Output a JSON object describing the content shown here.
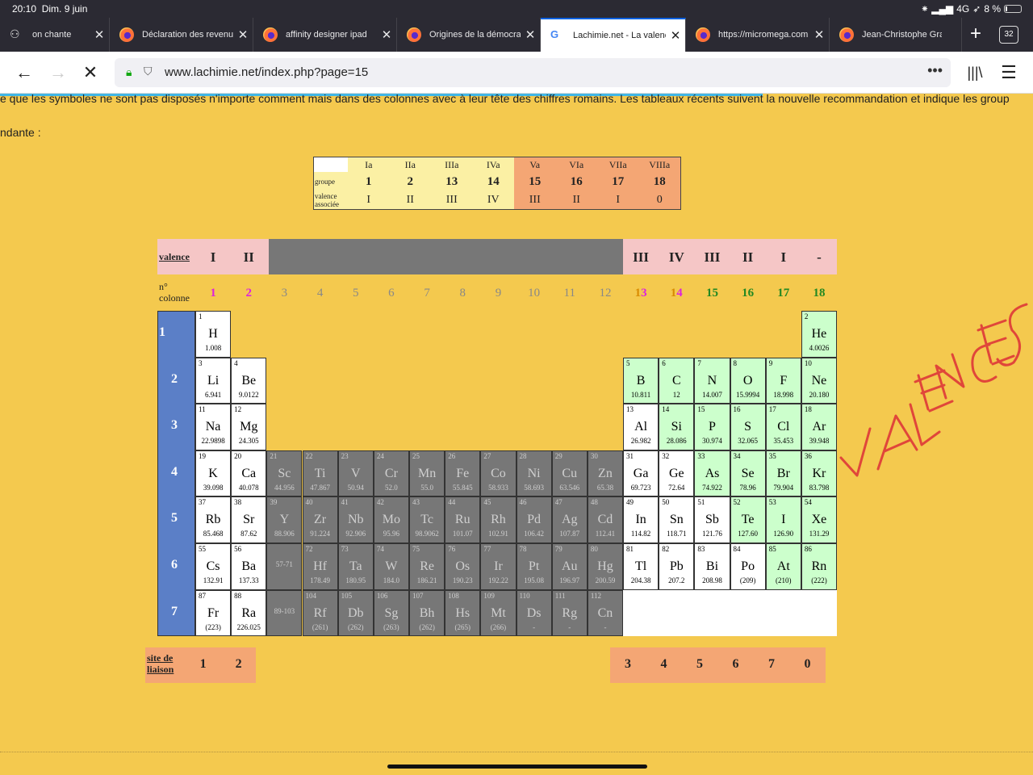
{
  "status": {
    "time": "20:10",
    "date": "Dim. 9 juin",
    "network": "4G",
    "battery": "8 %"
  },
  "tabs": [
    {
      "label": "on chante",
      "icon": "mask-icon",
      "x": 0
    },
    {
      "label": "Déclaration des revenus",
      "icon": "firefox-icon"
    },
    {
      "label": "affinity designer ipad",
      "icon": "firefox-icon"
    },
    {
      "label": "Origines de la démocratie",
      "icon": "firefox-icon"
    },
    {
      "label": "Lachimie.net - La valence",
      "icon": "google-icon",
      "active": true
    },
    {
      "label": "https://micromega.com",
      "icon": "firefox-icon"
    },
    {
      "label": "Jean-Christophe Granier",
      "icon": "firefox-icon"
    }
  ],
  "tab_count": "32",
  "url": "www.lachimie.net/index.php?page=15",
  "intro": {
    "line1": "e que les symboles ne sont pas disposés n'importe comment mais dans des colonnes avec à leur tête des chiffres romains. Les tableaux récents suivent la nouvelle recommandation et indique les group",
    "line2": "ndante :"
  },
  "group_table": {
    "roman": [
      "Ia",
      "IIa",
      "IIIa",
      "IVa",
      "Va",
      "VIa",
      "VIIa",
      "VIIIa"
    ],
    "groupe_label": "groupe",
    "groups": [
      "1",
      "2",
      "13",
      "14",
      "15",
      "16",
      "17",
      "18"
    ],
    "valence_label": "valence associée",
    "valences": [
      "I",
      "II",
      "III",
      "IV",
      "III",
      "II",
      "I",
      "0"
    ]
  },
  "periodic": {
    "valence_label": "valence",
    "valence_row": [
      "I",
      "II",
      "III",
      "IV",
      "III",
      "II",
      "I",
      "-"
    ],
    "col_label": "n° colonne",
    "columns": [
      "1",
      "2",
      "3",
      "4",
      "5",
      "6",
      "7",
      "8",
      "9",
      "10",
      "11",
      "12",
      "13",
      "14",
      "15",
      "16",
      "17",
      "18"
    ],
    "periods": [
      "1",
      "2",
      "3",
      "4",
      "5",
      "6",
      "7"
    ],
    "elements": [
      {
        "n": "1",
        "s": "H",
        "m": "1.008",
        "c": 1,
        "r": 1
      },
      {
        "n": "2",
        "s": "He",
        "m": "4.0026",
        "c": 18,
        "r": 1
      },
      {
        "n": "3",
        "s": "Li",
        "m": "6.941",
        "c": 1,
        "r": 2
      },
      {
        "n": "4",
        "s": "Be",
        "m": "9.0122",
        "c": 2,
        "r": 2
      },
      {
        "n": "5",
        "s": "B",
        "m": "10.811",
        "c": 13,
        "r": 2
      },
      {
        "n": "6",
        "s": "C",
        "m": "12",
        "c": 14,
        "r": 2
      },
      {
        "n": "7",
        "s": "N",
        "m": "14.007",
        "c": 15,
        "r": 2
      },
      {
        "n": "8",
        "s": "O",
        "m": "15.9994",
        "c": 16,
        "r": 2
      },
      {
        "n": "9",
        "s": "F",
        "m": "18.998",
        "c": 17,
        "r": 2
      },
      {
        "n": "10",
        "s": "Ne",
        "m": "20.180",
        "c": 18,
        "r": 2
      },
      {
        "n": "11",
        "s": "Na",
        "m": "22.9898",
        "c": 1,
        "r": 3
      },
      {
        "n": "12",
        "s": "Mg",
        "m": "24.305",
        "c": 2,
        "r": 3
      },
      {
        "n": "13",
        "s": "Al",
        "m": "26.982",
        "c": 13,
        "r": 3
      },
      {
        "n": "14",
        "s": "Si",
        "m": "28.086",
        "c": 14,
        "r": 3
      },
      {
        "n": "15",
        "s": "P",
        "m": "30.974",
        "c": 15,
        "r": 3
      },
      {
        "n": "16",
        "s": "S",
        "m": "32.065",
        "c": 16,
        "r": 3
      },
      {
        "n": "17",
        "s": "Cl",
        "m": "35.453",
        "c": 17,
        "r": 3
      },
      {
        "n": "18",
        "s": "Ar",
        "m": "39.948",
        "c": 18,
        "r": 3
      },
      {
        "n": "19",
        "s": "K",
        "m": "39.098",
        "c": 1,
        "r": 4
      },
      {
        "n": "20",
        "s": "Ca",
        "m": "40.078",
        "c": 2,
        "r": 4
      },
      {
        "n": "21",
        "s": "Sc",
        "m": "44.956",
        "c": 3,
        "r": 4
      },
      {
        "n": "22",
        "s": "Ti",
        "m": "47.867",
        "c": 4,
        "r": 4
      },
      {
        "n": "23",
        "s": "V",
        "m": "50.94",
        "c": 5,
        "r": 4
      },
      {
        "n": "24",
        "s": "Cr",
        "m": "52.0",
        "c": 6,
        "r": 4
      },
      {
        "n": "25",
        "s": "Mn",
        "m": "55.0",
        "c": 7,
        "r": 4
      },
      {
        "n": "26",
        "s": "Fe",
        "m": "55.845",
        "c": 8,
        "r": 4
      },
      {
        "n": "27",
        "s": "Co",
        "m": "58.933",
        "c": 9,
        "r": 4
      },
      {
        "n": "28",
        "s": "Ni",
        "m": "58.693",
        "c": 10,
        "r": 4
      },
      {
        "n": "29",
        "s": "Cu",
        "m": "63.546",
        "c": 11,
        "r": 4
      },
      {
        "n": "30",
        "s": "Zn",
        "m": "65.38",
        "c": 12,
        "r": 4
      },
      {
        "n": "31",
        "s": "Ga",
        "m": "69.723",
        "c": 13,
        "r": 4
      },
      {
        "n": "32",
        "s": "Ge",
        "m": "72.64",
        "c": 14,
        "r": 4
      },
      {
        "n": "33",
        "s": "As",
        "m": "74.922",
        "c": 15,
        "r": 4
      },
      {
        "n": "34",
        "s": "Se",
        "m": "78.96",
        "c": 16,
        "r": 4
      },
      {
        "n": "35",
        "s": "Br",
        "m": "79.904",
        "c": 17,
        "r": 4
      },
      {
        "n": "36",
        "s": "Kr",
        "m": "83.798",
        "c": 18,
        "r": 4
      },
      {
        "n": "37",
        "s": "Rb",
        "m": "85.468",
        "c": 1,
        "r": 5
      },
      {
        "n": "38",
        "s": "Sr",
        "m": "87.62",
        "c": 2,
        "r": 5
      },
      {
        "n": "39",
        "s": "Y",
        "m": "88.906",
        "c": 3,
        "r": 5
      },
      {
        "n": "40",
        "s": "Zr",
        "m": "91.224",
        "c": 4,
        "r": 5
      },
      {
        "n": "41",
        "s": "Nb",
        "m": "92.906",
        "c": 5,
        "r": 5
      },
      {
        "n": "42",
        "s": "Mo",
        "m": "95.96",
        "c": 6,
        "r": 5
      },
      {
        "n": "43",
        "s": "Tc",
        "m": "98.9062",
        "c": 7,
        "r": 5
      },
      {
        "n": "44",
        "s": "Ru",
        "m": "101.07",
        "c": 8,
        "r": 5
      },
      {
        "n": "45",
        "s": "Rh",
        "m": "102.91",
        "c": 9,
        "r": 5
      },
      {
        "n": "46",
        "s": "Pd",
        "m": "106.42",
        "c": 10,
        "r": 5
      },
      {
        "n": "47",
        "s": "Ag",
        "m": "107.87",
        "c": 11,
        "r": 5
      },
      {
        "n": "48",
        "s": "Cd",
        "m": "112.41",
        "c": 12,
        "r": 5
      },
      {
        "n": "49",
        "s": "In",
        "m": "114.82",
        "c": 13,
        "r": 5
      },
      {
        "n": "50",
        "s": "Sn",
        "m": "118.71",
        "c": 14,
        "r": 5
      },
      {
        "n": "51",
        "s": "Sb",
        "m": "121.76",
        "c": 15,
        "r": 5
      },
      {
        "n": "52",
        "s": "Te",
        "m": "127.60",
        "c": 16,
        "r": 5
      },
      {
        "n": "53",
        "s": "I",
        "m": "126.90",
        "c": 17,
        "r": 5
      },
      {
        "n": "54",
        "s": "Xe",
        "m": "131.29",
        "c": 18,
        "r": 5
      },
      {
        "n": "55",
        "s": "Cs",
        "m": "132.91",
        "c": 1,
        "r": 6
      },
      {
        "n": "56",
        "s": "Ba",
        "m": "137.33",
        "c": 2,
        "r": 6
      },
      {
        "n": "57-71",
        "s": "",
        "m": "",
        "c": 3,
        "r": 6
      },
      {
        "n": "72",
        "s": "Hf",
        "m": "178.49",
        "c": 4,
        "r": 6
      },
      {
        "n": "73",
        "s": "Ta",
        "m": "180.95",
        "c": 5,
        "r": 6
      },
      {
        "n": "74",
        "s": "W",
        "m": "184.0",
        "c": 6,
        "r": 6
      },
      {
        "n": "75",
        "s": "Re",
        "m": "186.21",
        "c": 7,
        "r": 6
      },
      {
        "n": "76",
        "s": "Os",
        "m": "190.23",
        "c": 8,
        "r": 6
      },
      {
        "n": "77",
        "s": "Ir",
        "m": "192.22",
        "c": 9,
        "r": 6
      },
      {
        "n": "78",
        "s": "Pt",
        "m": "195.08",
        "c": 10,
        "r": 6
      },
      {
        "n": "79",
        "s": "Au",
        "m": "196.97",
        "c": 11,
        "r": 6
      },
      {
        "n": "80",
        "s": "Hg",
        "m": "200.59",
        "c": 12,
        "r": 6
      },
      {
        "n": "81",
        "s": "Tl",
        "m": "204.38",
        "c": 13,
        "r": 6
      },
      {
        "n": "82",
        "s": "Pb",
        "m": "207.2",
        "c": 14,
        "r": 6
      },
      {
        "n": "83",
        "s": "Bi",
        "m": "208.98",
        "c": 15,
        "r": 6
      },
      {
        "n": "84",
        "s": "Po",
        "m": "(209)",
        "c": 16,
        "r": 6
      },
      {
        "n": "85",
        "s": "At",
        "m": "(210)",
        "c": 17,
        "r": 6
      },
      {
        "n": "86",
        "s": "Rn",
        "m": "(222)",
        "c": 18,
        "r": 6
      },
      {
        "n": "87",
        "s": "Fr",
        "m": "(223)",
        "c": 1,
        "r": 7
      },
      {
        "n": "88",
        "s": "Ra",
        "m": "226.025",
        "c": 2,
        "r": 7
      },
      {
        "n": "89-103",
        "s": "",
        "m": "",
        "c": 3,
        "r": 7
      },
      {
        "n": "104",
        "s": "Rf",
        "m": "(261)",
        "c": 4,
        "r": 7
      },
      {
        "n": "105",
        "s": "Db",
        "m": "(262)",
        "c": 5,
        "r": 7
      },
      {
        "n": "106",
        "s": "Sg",
        "m": "(263)",
        "c": 6,
        "r": 7
      },
      {
        "n": "107",
        "s": "Bh",
        "m": "(262)",
        "c": 7,
        "r": 7
      },
      {
        "n": "108",
        "s": "Hs",
        "m": "(265)",
        "c": 8,
        "r": 7
      },
      {
        "n": "109",
        "s": "Mt",
        "m": "(266)",
        "c": 9,
        "r": 7
      },
      {
        "n": "110",
        "s": "Ds",
        "m": "-",
        "c": 10,
        "r": 7
      },
      {
        "n": "111",
        "s": "Rg",
        "m": "-",
        "c": 11,
        "r": 7
      },
      {
        "n": "112",
        "s": "Cn",
        "m": "-",
        "c": 12,
        "r": 7
      }
    ]
  },
  "site": {
    "label": "site de liaison",
    "left": [
      "1",
      "2"
    ],
    "right": [
      "3",
      "4",
      "5",
      "6",
      "7",
      "0"
    ]
  },
  "handwriting": "VALENCES",
  "colors": {
    "page_bg": "#f4c94e",
    "s_block": "#ffffff",
    "p_block": "#ccffcc",
    "transition": "#777777",
    "period_col": "#5b7fc7",
    "valence_row": "#f5c6c6",
    "site_row": "#f4a674",
    "col_magenta": "#dd22dd",
    "col_green": "#228822",
    "col_gray": "#888888"
  }
}
